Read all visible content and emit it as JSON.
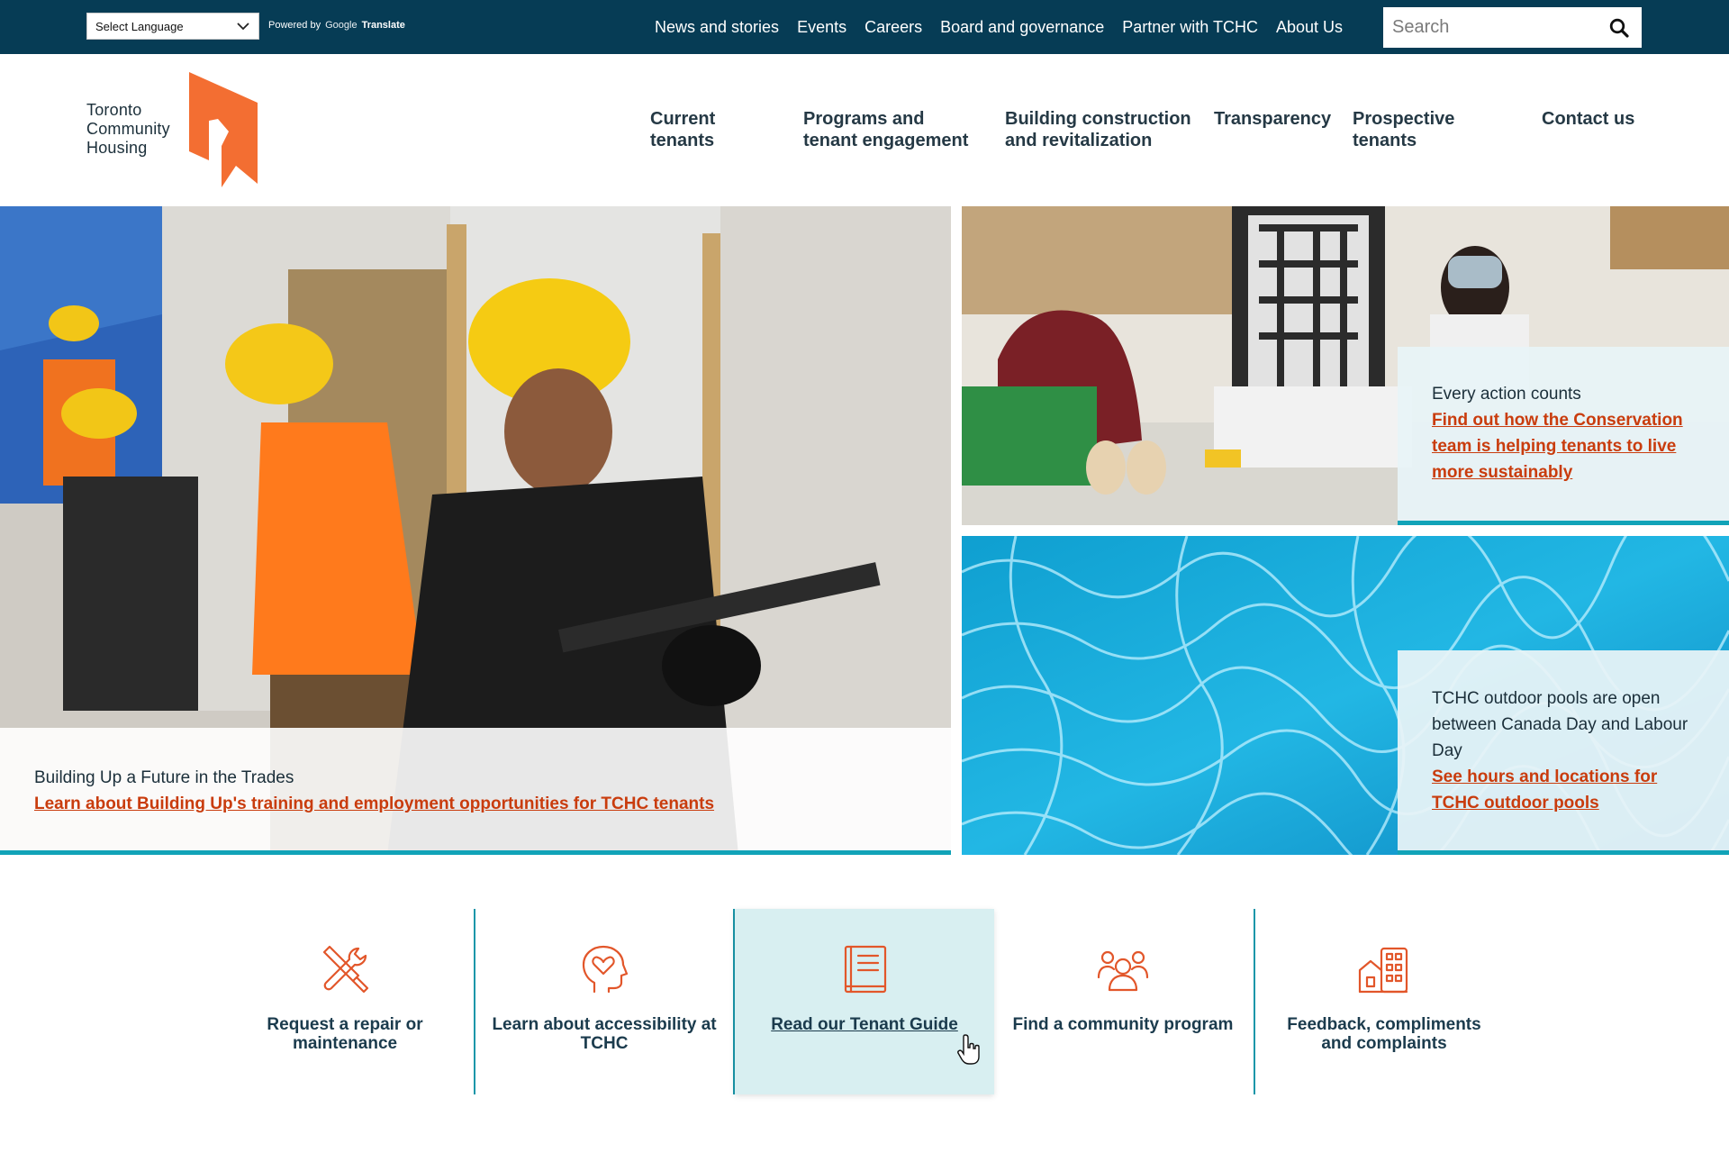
{
  "utility_bar": {
    "language_select": "Select Language",
    "powered_by": "Powered by",
    "google": "Google",
    "translate": "Translate",
    "links": [
      "News and stories",
      "Events",
      "Careers",
      "Board and governance",
      "Partner with TCHC",
      "About Us"
    ],
    "search_placeholder": "Search"
  },
  "logo": {
    "lines": [
      "Toronto",
      "Community",
      "Housing"
    ]
  },
  "main_nav": [
    "Current tenants",
    "Programs and tenant engagement",
    "Building construction and revitalization",
    "Transparency",
    "Prospective tenants",
    "Contact us"
  ],
  "hero": {
    "title": "Building Up a Future in the Trades",
    "link": "Learn about Building Up's training and employment opportunities for TCHC tenants"
  },
  "tiles": [
    {
      "title": "Every action counts",
      "link": "Find out how the Conservation team is helping tenants to live more sustainably"
    },
    {
      "title": "TCHC outdoor pools are open between Canada Day and Labour Day",
      "link": "See hours and locations for TCHC outdoor pools"
    }
  ],
  "quick_links": [
    {
      "label": "Request a repair or maintenance",
      "icon": "repair-tools-icon"
    },
    {
      "label": "Learn about accessibility at TCHC",
      "icon": "accessibility-heart-head-icon"
    },
    {
      "label": "Read our Tenant Guide",
      "icon": "book-icon"
    },
    {
      "label": "Find a community program",
      "icon": "people-group-icon"
    },
    {
      "label": "Feedback, compliments and complaints",
      "icon": "buildings-icon"
    }
  ],
  "colors": {
    "utility_bar": "#063c55",
    "accent_orange": "#f36e32",
    "link_orange": "#c93c0d",
    "teal_border": "#11a3b8",
    "active_tile_bg": "#d8eff1"
  }
}
